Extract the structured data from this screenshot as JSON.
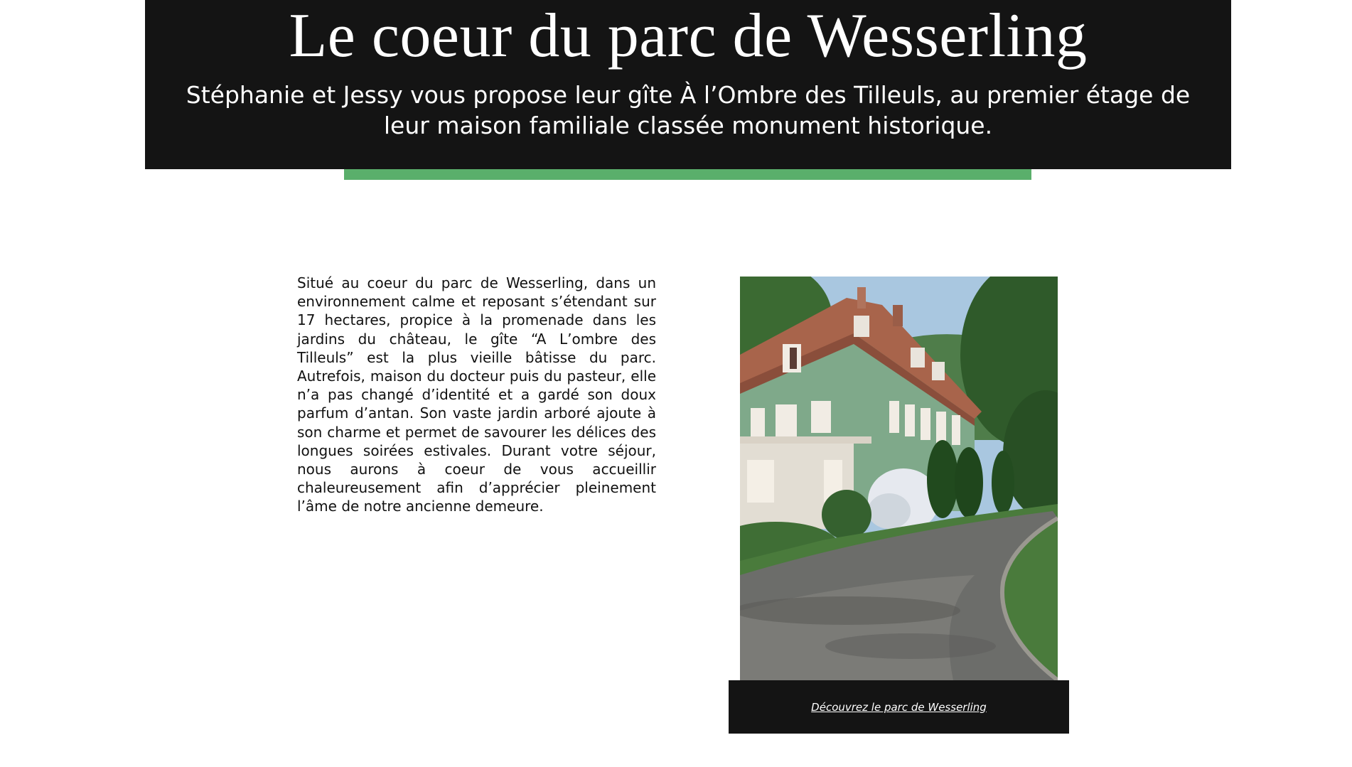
{
  "hero": {
    "title": "Le coeur du parc de Wesserling",
    "subtitle": "Stéphanie et Jessy vous propose leur gîte À l’Ombre des Tilleuls, au premier étage de leur maison familiale classée monument historique."
  },
  "intro": {
    "paragraph": "Situé au coeur du parc de Wesserling, dans un environnement calme et reposant s’étendant sur 17 hectares, propice à la promenade dans les jardins du château, le gîte “A L’ombre des Tilleuls” est la plus vieille bâtisse du parc. Autrefois, maison du docteur puis du pasteur, elle n’a pas changé d’identité et a gardé son doux parfum d’antan. Son vaste jardin arboré ajoute à son charme et permet de savourer les délices des longues soirées estivales. Durant votre séjour, nous aurons à coeur de vous accueillir chaleureusement afin d’apprécier pleinement l’âme de notre ancienne demeure."
  },
  "photo": {
    "subject": "green-house-photo"
  },
  "caption": {
    "link_label": "Découvrez le parc de Wesserling"
  },
  "colors": {
    "dark": "#141414",
    "accent_green": "#5aaf6b",
    "white": "#ffffff"
  }
}
